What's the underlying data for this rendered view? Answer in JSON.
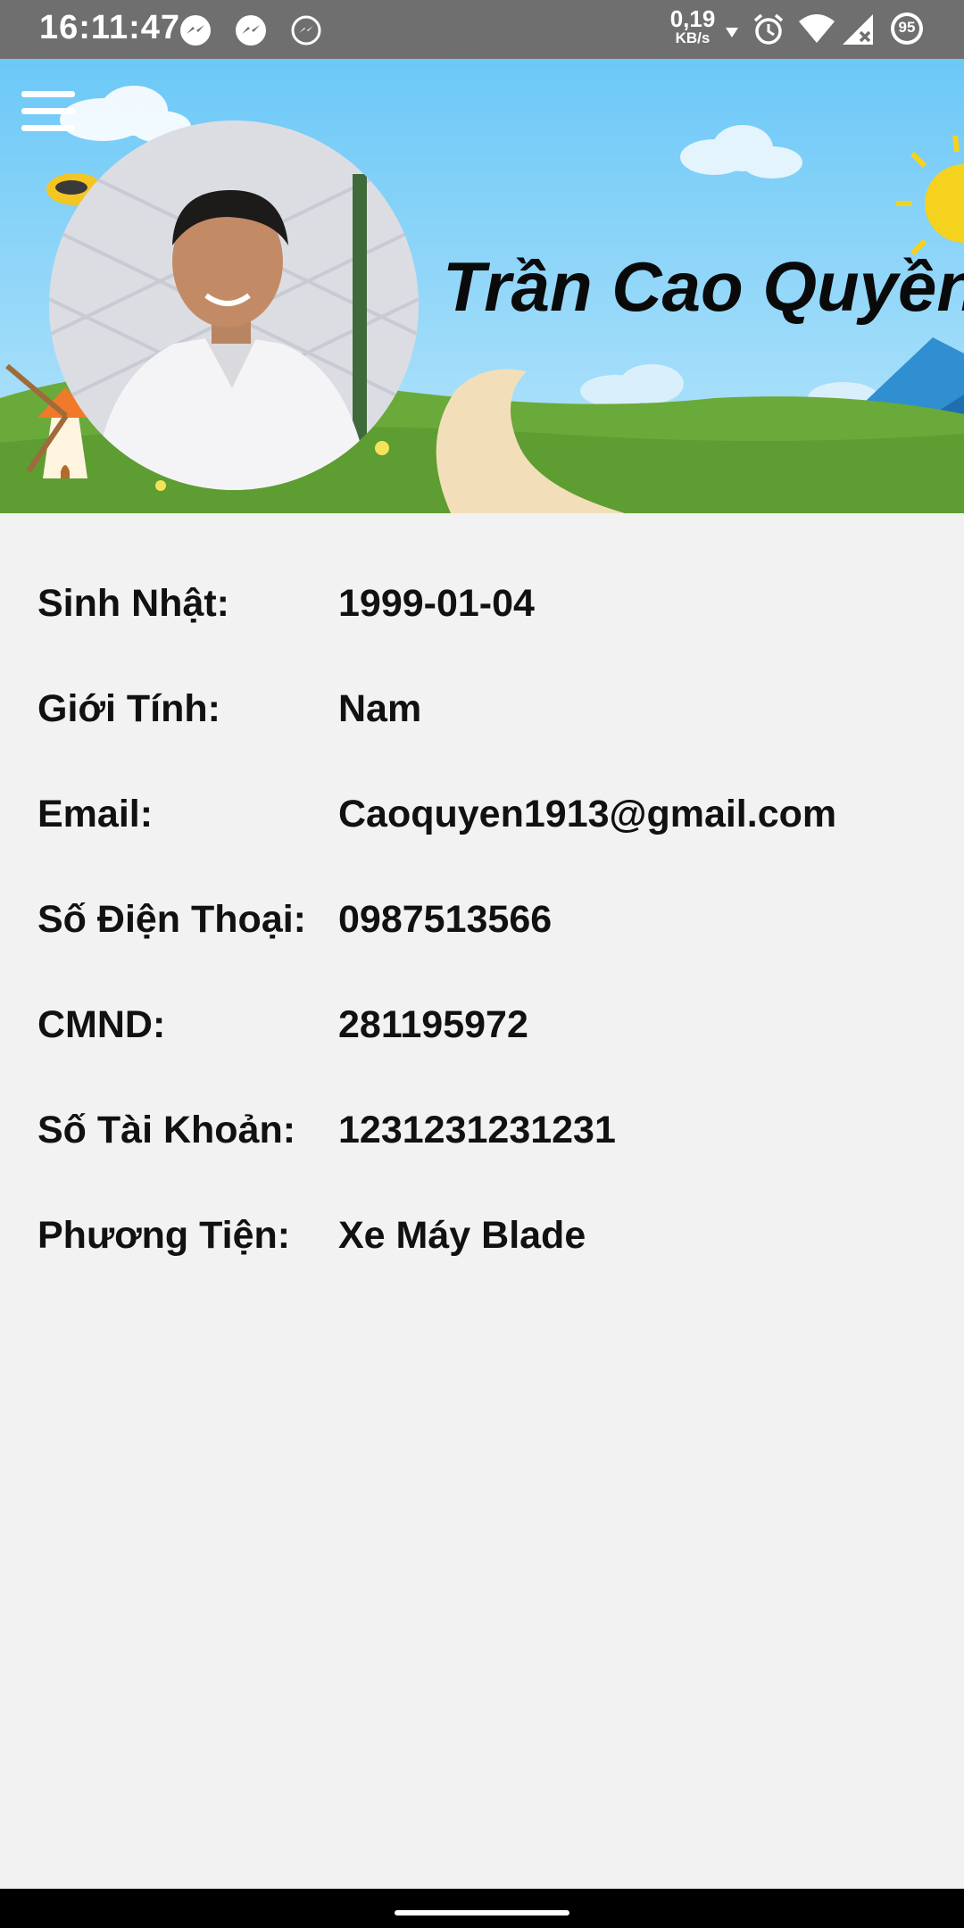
{
  "status_bar": {
    "time": "16:11:47",
    "net_speed_value": "0,19",
    "net_speed_unit": "KB/s",
    "battery": "95",
    "icons": [
      "messenger-icon",
      "messenger-icon",
      "messenger-outline-icon",
      "download-arrow-icon",
      "alarm-icon",
      "wifi-icon",
      "signal-no-service-icon",
      "battery-icon"
    ]
  },
  "header": {
    "menu_icon": "hamburger-menu-icon",
    "name": "Trần Cao Quyền"
  },
  "profile": [
    {
      "label": "Sinh Nhật:",
      "value": "1999-01-04"
    },
    {
      "label": "Giới Tính:",
      "value": "Nam"
    },
    {
      "label": "Email:",
      "value": "Caoquyen1913@gmail.com"
    },
    {
      "label": "Số Điện Thoại:",
      "value": "0987513566"
    },
    {
      "label": "CMND:",
      "value": "281195972"
    },
    {
      "label": "Số Tài Khoản:",
      "value": "1231231231231"
    },
    {
      "label": "Phương Tiện:",
      "value": "Xe Máy Blade"
    }
  ],
  "colors": {
    "status_bar": "#6f6f6f",
    "sky": "#7fd0f8",
    "grass": "#6aaa3a",
    "page_background": "#f2f2f2",
    "text": "#111111"
  }
}
